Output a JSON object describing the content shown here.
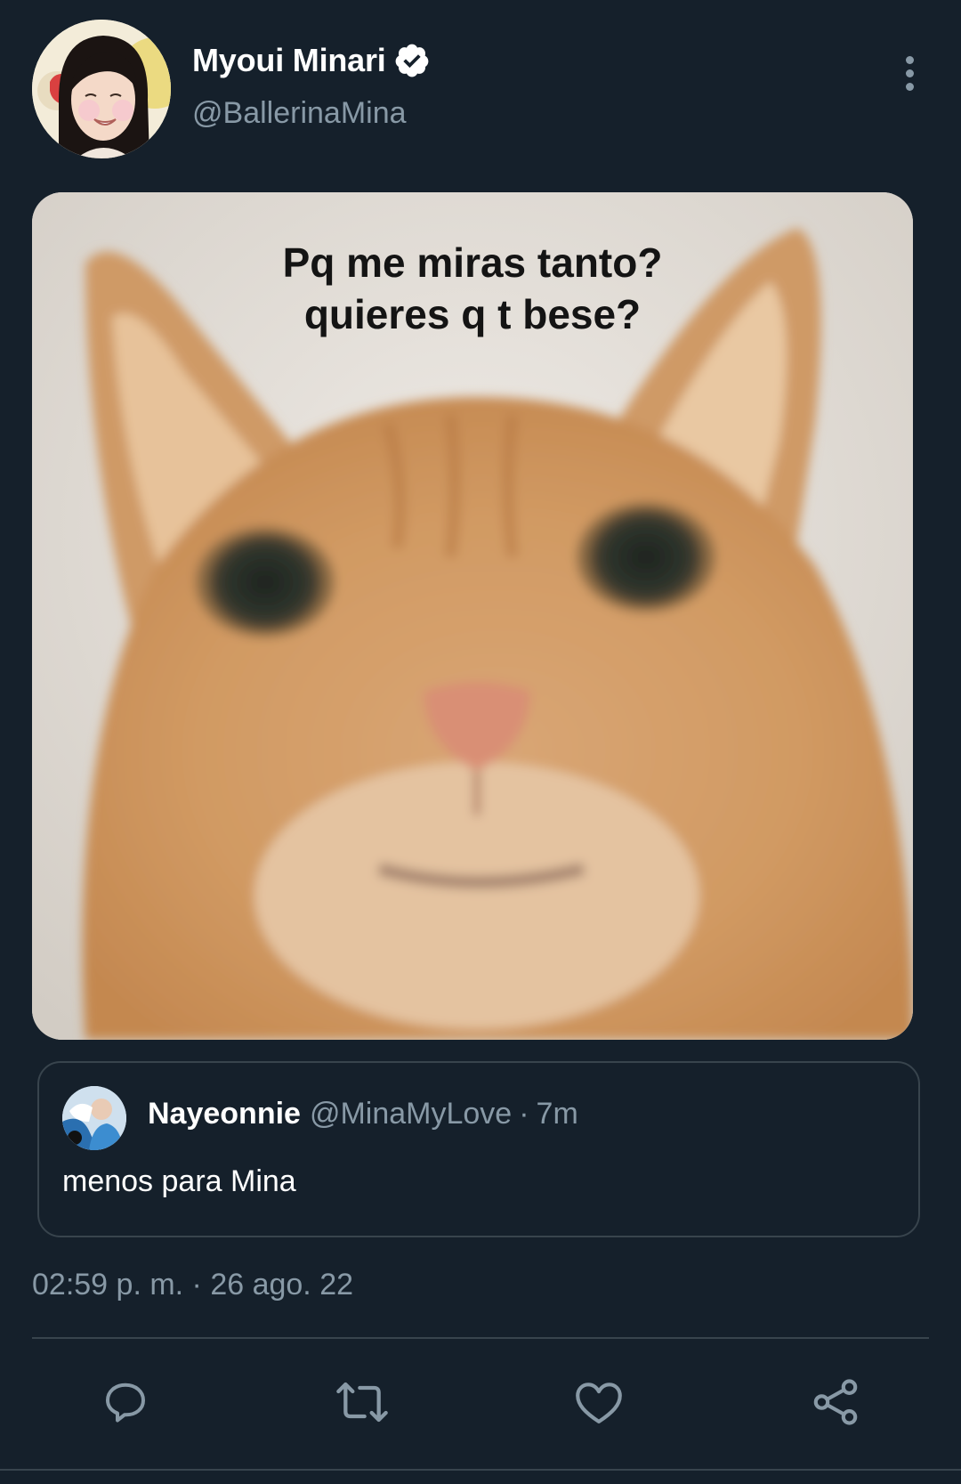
{
  "tweet": {
    "author": {
      "display_name": "Myoui Minari",
      "handle": "@BallerinaMina",
      "verified": true,
      "avatar_icon": "profile-photo"
    },
    "media": {
      "caption_line1": "Pq me miras tanto?",
      "caption_line2": "quieres q t bese?"
    },
    "quoted_tweet": {
      "display_name": "Nayeonnie",
      "handle": "@MinaMyLove",
      "separator": "·",
      "time": "7m",
      "text": "menos para Mina"
    },
    "timestamp": "02:59 p. m. · 26 ago. 22"
  },
  "actions": [
    {
      "name": "reply",
      "icon": "speech-bubble-icon"
    },
    {
      "name": "retweet",
      "icon": "retweet-icon"
    },
    {
      "name": "like",
      "icon": "heart-icon"
    },
    {
      "name": "share",
      "icon": "share-icon"
    }
  ],
  "colors": {
    "background": "#15202b",
    "secondary_text": "#8899a6",
    "border": "#38444d",
    "primary_text": "#ffffff"
  }
}
